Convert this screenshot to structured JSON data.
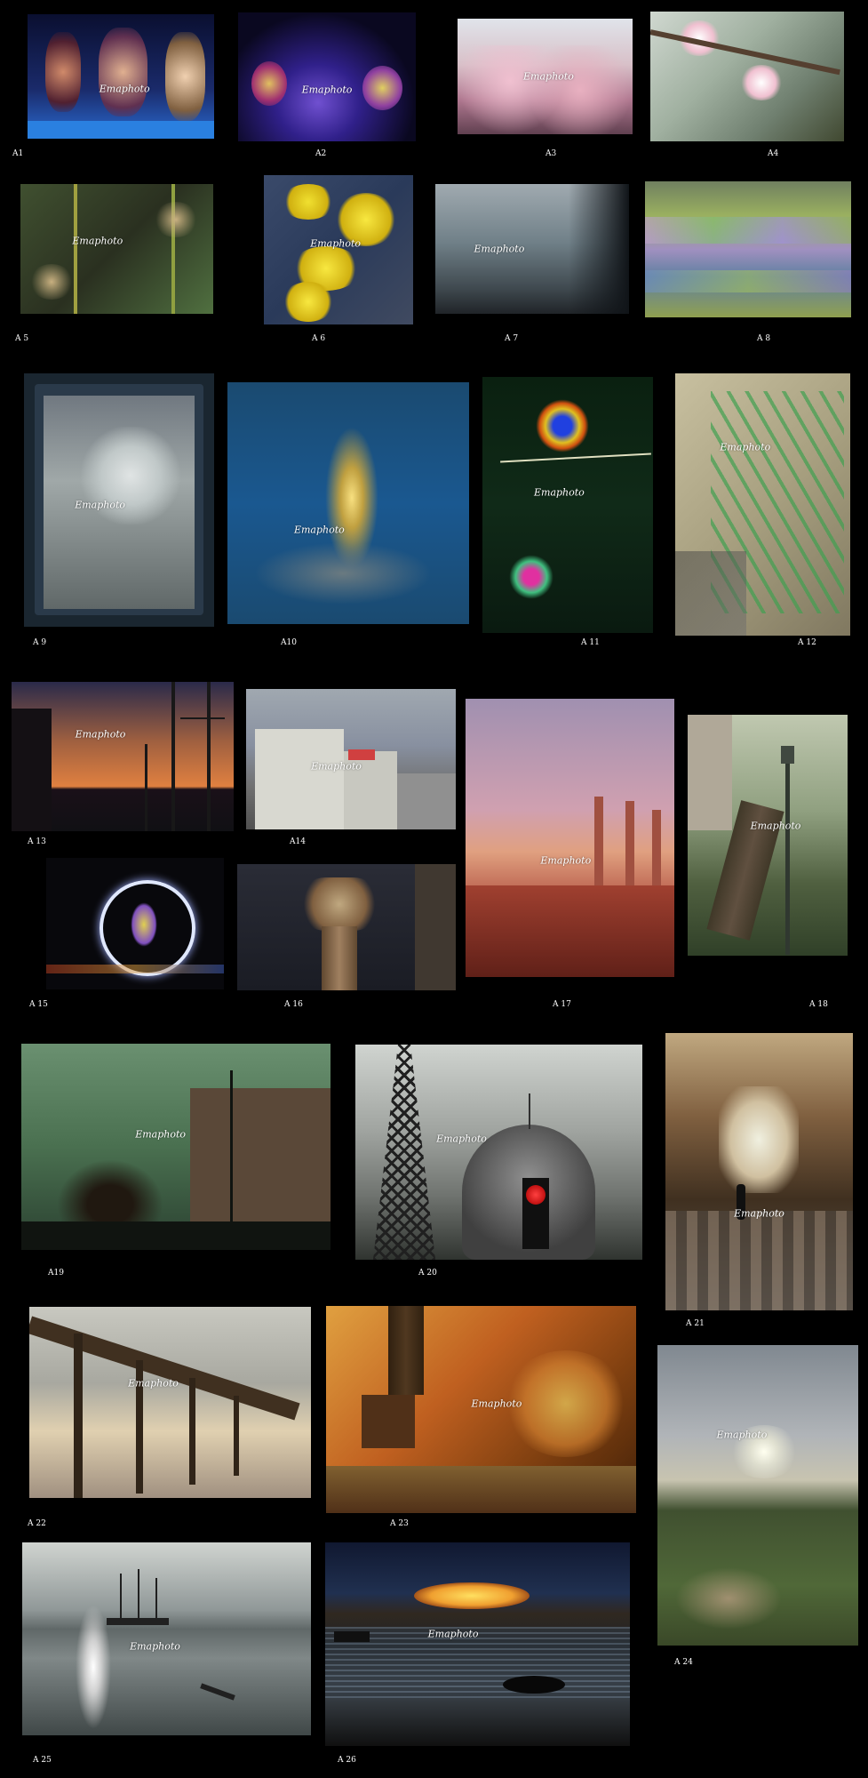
{
  "watermark": "Emaphoto",
  "photos": [
    {
      "id": "A1",
      "caption": "A1",
      "subject": "dancers on stage"
    },
    {
      "id": "A2",
      "caption": "A2",
      "subject": "blurred dancers in violet light"
    },
    {
      "id": "A3",
      "caption": "A3",
      "subject": "flowering tree"
    },
    {
      "id": "A4",
      "caption": "A4",
      "subject": "cherry blossom branch"
    },
    {
      "id": "A5",
      "caption": "A 5",
      "subject": "willow catkins"
    },
    {
      "id": "A6",
      "caption": "A 6",
      "subject": "yellow flowers on denim"
    },
    {
      "id": "A7",
      "caption": "A 7",
      "subject": "raindrops on window"
    },
    {
      "id": "A8",
      "caption": "A 8",
      "subject": "motion-blurred foliage"
    },
    {
      "id": "A9",
      "caption": "A 9",
      "subject": "frosted window"
    },
    {
      "id": "A10",
      "caption": "A10",
      "subject": "light reflection on blue surface"
    },
    {
      "id": "A11",
      "caption": "A 11",
      "subject": "soap bubbles"
    },
    {
      "id": "A12",
      "caption": "A 12",
      "subject": "graffiti wall"
    },
    {
      "id": "A13",
      "caption": "A 13",
      "subject": "harbour sunset"
    },
    {
      "id": "A14",
      "caption": "A14",
      "subject": "city buildings"
    },
    {
      "id": "A15",
      "caption": "A 15",
      "subject": "ferris wheel at night"
    },
    {
      "id": "A16",
      "caption": "A 16",
      "subject": "column capital"
    },
    {
      "id": "A17",
      "caption": "A 17",
      "subject": "factory chimneys at dusk"
    },
    {
      "id": "A18",
      "caption": "A 18",
      "subject": "street lamp and tree"
    },
    {
      "id": "A19",
      "caption": "A19",
      "subject": "green sky over buildings"
    },
    {
      "id": "A20",
      "caption": "A 20",
      "subject": "eiffel tower and dome with red light"
    },
    {
      "id": "A21",
      "caption": "A 21",
      "subject": "covered passage"
    },
    {
      "id": "A22",
      "caption": "A 22",
      "subject": "wooden pier"
    },
    {
      "id": "A23",
      "caption": "A 23",
      "subject": "bench in autumn forest"
    },
    {
      "id": "A24",
      "caption": "A 24",
      "subject": "sun over hills"
    },
    {
      "id": "A25",
      "caption": "A 25",
      "subject": "sailboats and seagull"
    },
    {
      "id": "A26",
      "caption": "A 26",
      "subject": "sunset over sea"
    }
  ]
}
